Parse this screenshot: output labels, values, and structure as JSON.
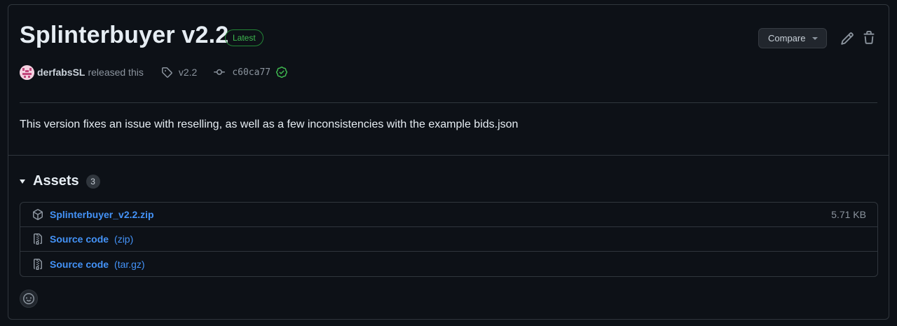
{
  "release": {
    "title": "Splinterbuyer v2.2",
    "badge": "Latest",
    "compare_label": "Compare",
    "author": "derfabsSL",
    "released_text": "released this",
    "tag": "v2.2",
    "commit": "c60ca77",
    "description": "This version fixes an issue with reselling, as well as a few inconsistencies with the example bids.json"
  },
  "assets": {
    "title": "Assets",
    "count": "3",
    "items": [
      {
        "name": "Splinterbuyer_v2.2.zip",
        "suffix": "",
        "size": "5.71 KB",
        "icon": "package-icon"
      },
      {
        "name": "Source code",
        "suffix": "(zip)",
        "size": "",
        "icon": "file-zip-icon"
      },
      {
        "name": "Source code",
        "suffix": "(tar.gz)",
        "size": "",
        "icon": "file-zip-icon"
      }
    ]
  },
  "colors": {
    "background": "#0d1117",
    "border": "#30363d",
    "link": "#4493f8",
    "success": "#3fb950",
    "muted": "#8b949e"
  }
}
